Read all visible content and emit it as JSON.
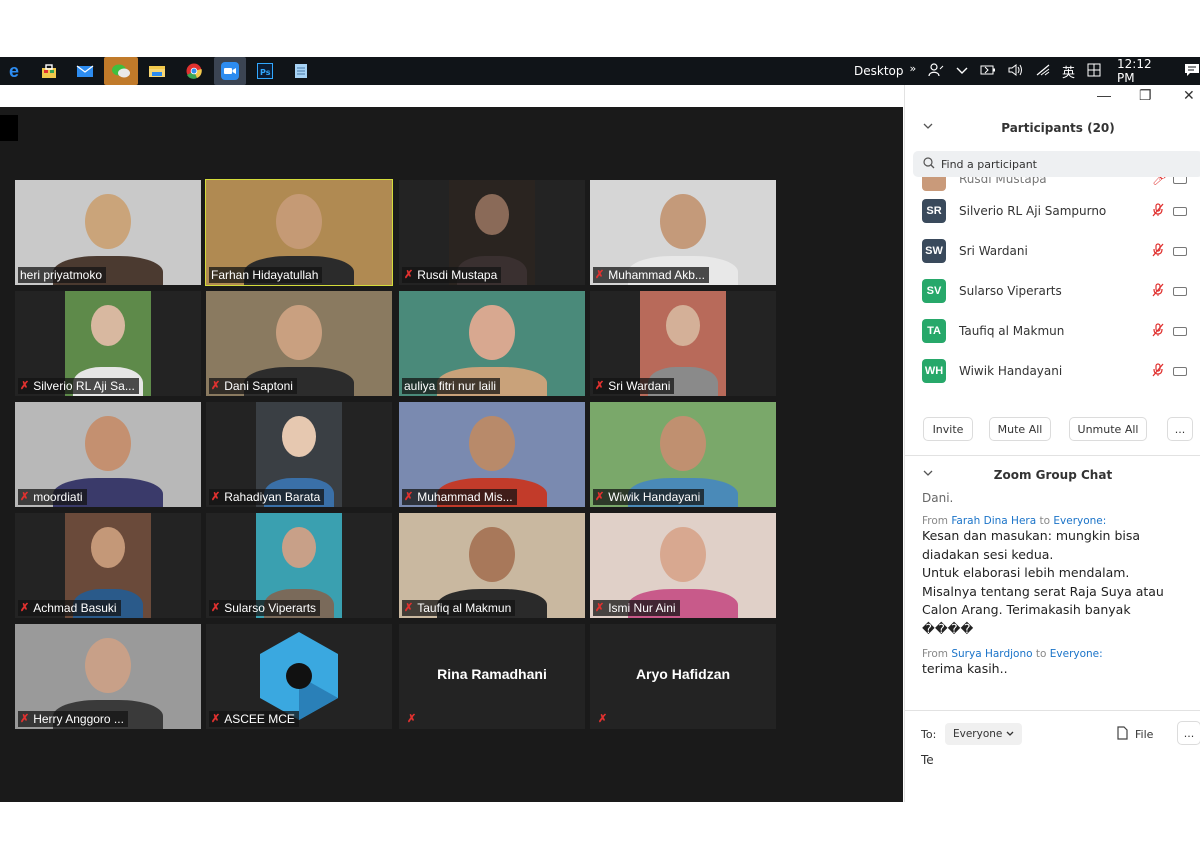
{
  "taskbar": {
    "desktop_label": "Desktop",
    "overflow": "»",
    "ime_label": "英",
    "time": "12:12 PM",
    "icons": [
      "edge-icon",
      "store-icon",
      "mail-icon",
      "wechat-icon",
      "file-explorer-icon",
      "chrome-icon",
      "zoom-icon",
      "photoshop-icon",
      "notepad-icon"
    ]
  },
  "window": {
    "minimize": "—",
    "restore": "❐",
    "close": "✕"
  },
  "tiles": [
    {
      "name": "heri priyatmoko",
      "muted": false
    },
    {
      "name": "Farhan Hidayatullah",
      "muted": false,
      "active_speaker": true
    },
    {
      "name": "Rusdi Mustapa",
      "muted": true
    },
    {
      "name": "Muhammad Akb...",
      "muted": true
    },
    {
      "name": "Silverio RL Aji Sa...",
      "muted": true
    },
    {
      "name": "Dani Saptoni",
      "muted": true
    },
    {
      "name": "auliya fitri nur laili",
      "muted": false
    },
    {
      "name": "Sri Wardani",
      "muted": true
    },
    {
      "name": "moordiati",
      "muted": true
    },
    {
      "name": "Rahadiyan Barata",
      "muted": true
    },
    {
      "name": "Muhammad Mis...",
      "muted": true
    },
    {
      "name": "Wiwik Handayani",
      "muted": true
    },
    {
      "name": "Achmad Basuki",
      "muted": true
    },
    {
      "name": "Sularso Viperarts",
      "muted": true
    },
    {
      "name": "Taufiq al Makmun",
      "muted": true
    },
    {
      "name": "Ismi Nur Aini",
      "muted": true
    },
    {
      "name": "Herry Anggoro ...",
      "muted": true
    },
    {
      "name": "ASCEE MCE",
      "muted": true
    },
    {
      "name": "Rina Ramadhani",
      "muted": true,
      "video_off": true
    },
    {
      "name": "Aryo Hafidzan",
      "muted": true,
      "video_off": true
    }
  ],
  "participants_panel": {
    "title": "Participants (20)",
    "search_placeholder": "Find a participant",
    "partial_row": "Rusdi Mustapa",
    "rows": [
      {
        "initials": "SR",
        "name": "Silverio RL Aji Sampurno",
        "color": "#3a4a5c"
      },
      {
        "initials": "SW",
        "name": "Sri Wardani",
        "color": "#3a4a5c"
      },
      {
        "initials": "SV",
        "name": "Sularso Viperarts",
        "color": "#27a86a"
      },
      {
        "initials": "TA",
        "name": "Taufiq al Makmun",
        "color": "#27a86a"
      },
      {
        "initials": "WH",
        "name": "Wiwik Handayani",
        "color": "#27a86a"
      }
    ],
    "buttons": {
      "invite": "Invite",
      "mute_all": "Mute All",
      "unmute_all": "Unmute All",
      "more": "..."
    }
  },
  "chat_panel": {
    "title": "Zoom Group Chat",
    "cut_line": "Dani.",
    "messages": [
      {
        "from_prefix": "From",
        "sender": "Farah Dina Hera",
        "to_prefix": "to",
        "recipient": "Everyone:",
        "lines": [
          "Kesan dan masukan: mungkin bisa",
          "diadakan sesi kedua.",
          "Untuk elaborasi lebih mendalam.",
          "Misalnya tentang serat Raja Suya atau",
          "Calon Arang. Terimakasih banyak",
          "����"
        ]
      },
      {
        "from_prefix": "From",
        "sender": "Surya Hardjono",
        "to_prefix": "to",
        "recipient": "Everyone:",
        "lines": [
          "terima kasih.."
        ]
      }
    ],
    "to_label": "To:",
    "to_value": "Everyone",
    "file_label": "File",
    "more": "...",
    "input_text": "Te"
  },
  "colors": {
    "video_bg": "#1a1a1a",
    "speaker_border": "#d4dc3a",
    "muted_red": "#e0312f",
    "link_blue": "#1a73c8"
  }
}
